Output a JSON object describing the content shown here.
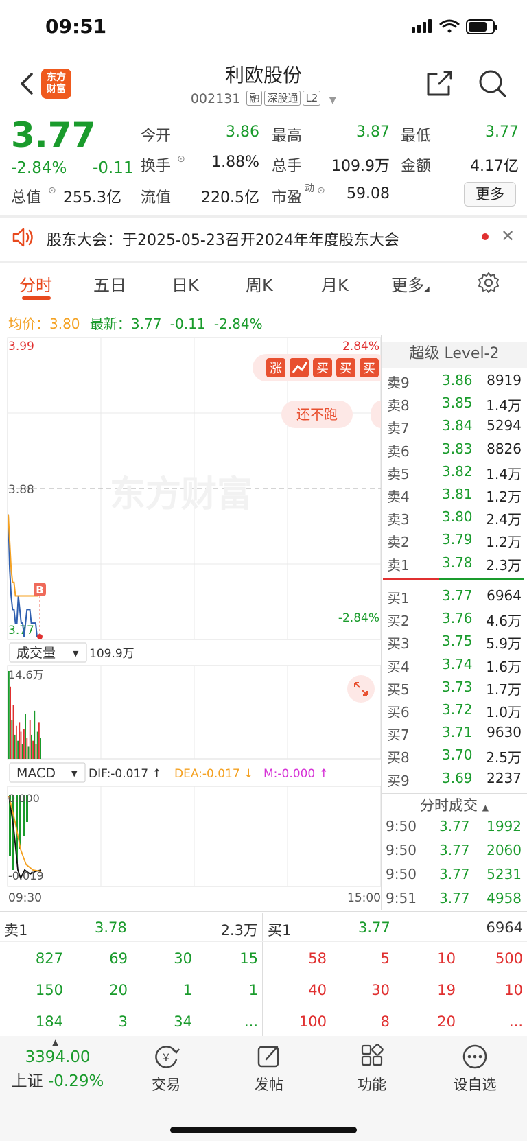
{
  "status_bar": {
    "time": "09:51"
  },
  "header": {
    "logo_text": "东方财富",
    "stock_name": "利欧股份",
    "stock_code": "002131",
    "tags": [
      "融",
      "深股通",
      "L2"
    ]
  },
  "quote": {
    "price": "3.77",
    "change_pct": "-2.84%",
    "change": "-0.11",
    "fields": [
      {
        "label": "今开",
        "value": "3.86",
        "color": "#1a9b2c"
      },
      {
        "label": "最高",
        "value": "3.87",
        "color": "#1a9b2c"
      },
      {
        "label": "最低",
        "value": "3.77",
        "color": "#1a9b2c"
      },
      {
        "label": "换手",
        "value": "1.88%",
        "color": "#222"
      },
      {
        "label": "总手",
        "value": "109.9万",
        "color": "#222"
      },
      {
        "label": "金额",
        "value": "4.17亿",
        "color": "#222"
      },
      {
        "label": "总值",
        "value": "255.3亿",
        "color": "#222"
      },
      {
        "label": "流值",
        "value": "220.5亿",
        "color": "#222"
      },
      {
        "label": "市盈",
        "value": "59.08",
        "color": "#222"
      }
    ],
    "pe_sup": "动",
    "more_label": "更多"
  },
  "notice": {
    "text": "股东大会：于2025-05-23召开2024年年度股东大会"
  },
  "tabs": [
    "分时",
    "五日",
    "日K",
    "周K",
    "月K",
    "更多",
    "settings"
  ],
  "info_line": {
    "avg_label": "均价：",
    "avg_value": "3.80",
    "latest_label": "最新：",
    "latest_value": "3.77",
    "latest_change": "-0.11",
    "latest_pct": "-2.84%"
  },
  "chart": {
    "y_high": "3.99",
    "y_mid": "3.88",
    "y_low": "3.77",
    "pct_high": "2.84%",
    "pct_low": "-2.84%",
    "watermark": "东方财富",
    "banner_chars": [
      "涨",
      "买",
      "买",
      "买"
    ],
    "banner_text": "还不跑",
    "marker": "B",
    "volume_label": "成交量",
    "volume_value": "109.9万",
    "volume_max": "14.6万",
    "macd_label": "MACD",
    "dif": "DIF:-0.017 ↑",
    "dea": "DEA:-0.017 ↓",
    "m": "M:-0.000 ↑",
    "macd_top": "0.000",
    "macd_bottom": "-0.019",
    "time_start": "09:30",
    "time_end": "15:00"
  },
  "chart_data": {
    "type": "line",
    "title": "",
    "x": [
      "09:30",
      "09:31",
      "09:32",
      "09:33",
      "09:34",
      "09:35",
      "09:36",
      "09:37",
      "09:38",
      "09:39",
      "09:40",
      "09:41",
      "09:42",
      "09:43",
      "09:44",
      "09:45",
      "09:46",
      "09:47",
      "09:48",
      "09:49",
      "09:50",
      "09:51"
    ],
    "series": [
      {
        "values": [
          3.86,
          3.82,
          3.8,
          3.79,
          3.79,
          3.78,
          3.78,
          3.8,
          3.79,
          3.78,
          3.78,
          3.77,
          3.78,
          3.79,
          3.79,
          3.79,
          3.78,
          3.78,
          3.78,
          3.78,
          3.77,
          3.77
        ],
        "color": "#2f5fb0"
      },
      {
        "name": "均价",
        "values": [
          3.86,
          3.84,
          3.82,
          3.81,
          3.81,
          3.8,
          3.8,
          3.8,
          3.8,
          3.8,
          3.8,
          3.8,
          3.8,
          3.8,
          3.8,
          3.8,
          3.8,
          3.8,
          3.8,
          3.8,
          3.8,
          3.8
        ],
        "color": "#f4a122"
      }
    ],
    "ylim": [
      3.77,
      3.99
    ],
    "prev_close": 3.88
  },
  "volume_data": {
    "values": [
      14.6,
      12.0,
      6.5,
      9.0,
      4.0,
      5.5,
      3.0,
      6.0,
      4.5,
      2.5,
      5.0,
      7.5,
      3.5,
      2.0,
      6.5,
      4.0,
      3.0,
      8.0,
      2.5,
      4.5,
      6.0,
      3.5
    ],
    "up": [
      false,
      true,
      false,
      true,
      false,
      true,
      false,
      true,
      true,
      false,
      true,
      false,
      true,
      false,
      true,
      false,
      true,
      false,
      true,
      false,
      true,
      false
    ],
    "max": 14.6
  },
  "order_book": {
    "title": "超级 Level-2",
    "asks": [
      {
        "label": "卖9",
        "price": "3.86",
        "vol": "8919"
      },
      {
        "label": "卖8",
        "price": "3.85",
        "vol": "1.4万"
      },
      {
        "label": "卖7",
        "price": "3.84",
        "vol": "5294"
      },
      {
        "label": "卖6",
        "price": "3.83",
        "vol": "8826"
      },
      {
        "label": "卖5",
        "price": "3.82",
        "vol": "1.4万"
      },
      {
        "label": "卖4",
        "price": "3.81",
        "vol": "1.2万"
      },
      {
        "label": "卖3",
        "price": "3.80",
        "vol": "2.4万"
      },
      {
        "label": "卖2",
        "price": "3.79",
        "vol": "1.2万"
      },
      {
        "label": "卖1",
        "price": "3.78",
        "vol": "2.3万"
      }
    ],
    "bids": [
      {
        "label": "买1",
        "price": "3.77",
        "vol": "6964"
      },
      {
        "label": "买2",
        "price": "3.76",
        "vol": "4.6万"
      },
      {
        "label": "买3",
        "price": "3.75",
        "vol": "5.9万"
      },
      {
        "label": "买4",
        "price": "3.74",
        "vol": "1.6万"
      },
      {
        "label": "买5",
        "price": "3.73",
        "vol": "1.7万"
      },
      {
        "label": "买6",
        "price": "3.72",
        "vol": "1.0万"
      },
      {
        "label": "买7",
        "price": "3.71",
        "vol": "9630"
      },
      {
        "label": "买8",
        "price": "3.70",
        "vol": "2.5万"
      },
      {
        "label": "买9",
        "price": "3.69",
        "vol": "2237"
      }
    ],
    "ask_ratio": 0.4
  },
  "ticks": {
    "title": "分时成交",
    "rows": [
      {
        "time": "9:50",
        "price": "3.77",
        "vol": "1992"
      },
      {
        "time": "9:50",
        "price": "3.77",
        "vol": "2060"
      },
      {
        "time": "9:50",
        "price": "3.77",
        "vol": "5231"
      },
      {
        "time": "9:51",
        "price": "3.77",
        "vol": "4958"
      }
    ]
  },
  "bottom_book": {
    "sell_label": "卖1",
    "sell_price": "3.78",
    "sell_vol": "2.3万",
    "buy_label": "买1",
    "buy_price": "3.77",
    "buy_vol": "6964",
    "sell_rows": [
      [
        "827",
        "69",
        "30",
        "15"
      ],
      [
        "150",
        "20",
        "1",
        "1"
      ],
      [
        "184",
        "3",
        "34",
        "..."
      ]
    ],
    "buy_rows": [
      [
        "58",
        "5",
        "10",
        "500"
      ],
      [
        "40",
        "30",
        "19",
        "10"
      ],
      [
        "100",
        "8",
        "20",
        "..."
      ]
    ]
  },
  "bottom_nav": {
    "index_value": "3394.00",
    "index_name": "上证",
    "index_pct": "-0.29%",
    "items": [
      "交易",
      "发帖",
      "功能",
      "设自选"
    ]
  }
}
